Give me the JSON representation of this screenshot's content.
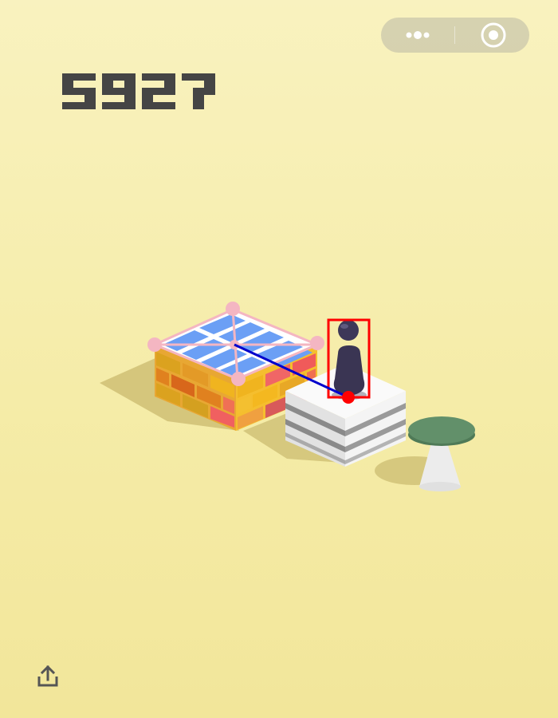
{
  "game": {
    "score": "5927",
    "colors": {
      "score": "#454545",
      "target_box_stroke": "#ff0000",
      "jump_line": "#0000cc",
      "keypoint": "#ffc0cb"
    }
  },
  "capsule": {
    "menu_icon": "more-dots-icon",
    "close_icon": "target-circle-icon"
  },
  "footer": {
    "share_icon": "share-upload-icon"
  }
}
